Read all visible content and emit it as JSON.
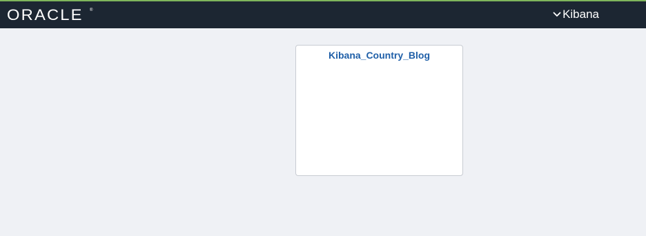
{
  "header": {
    "logo_text": "ORACLE",
    "logo_mark": "®",
    "nav_label": "Kibana",
    "nav_icon": "chevron-down-icon",
    "accent_color": "#7fb65c",
    "background_color": "#1c2632"
  },
  "main": {
    "tiles": [
      {
        "title": "Kibana_Country_Blog"
      }
    ]
  }
}
